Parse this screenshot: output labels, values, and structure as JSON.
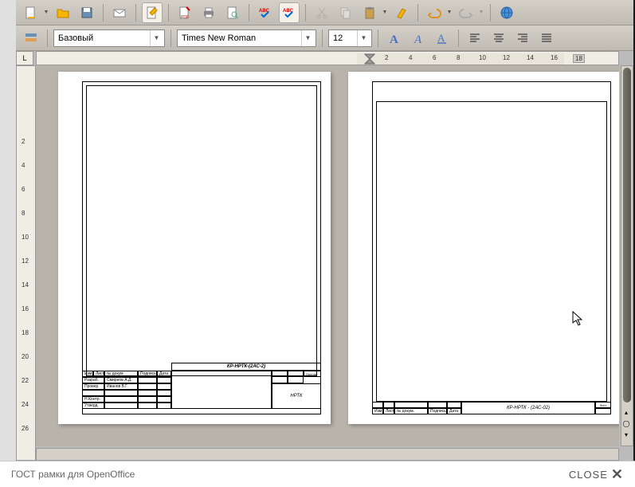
{
  "toolbar1": {
    "icons": [
      "new-doc",
      "open",
      "save",
      "mail",
      "edit-doc",
      "export-pdf",
      "print",
      "print-preview",
      "spellcheck-abc",
      "spellcheck-auto",
      "cut",
      "copy",
      "paste",
      "format-paint",
      "undo",
      "redo",
      "web"
    ]
  },
  "toolbar2": {
    "style_label": "Базовый",
    "font_name": "Times New Roman",
    "font_size": "12"
  },
  "ruler": {
    "h": [
      "2",
      "4",
      "6",
      "8",
      "10",
      "12",
      "14",
      "16",
      "18"
    ],
    "v": [
      "2",
      "4",
      "6",
      "8",
      "10",
      "12",
      "14",
      "16",
      "18",
      "20",
      "22",
      "24",
      "26"
    ]
  },
  "page1": {
    "doc_code": "КР-НРТК-(2АС-2)",
    "rows": [
      {
        "c1": "Изм",
        "c2": "Лист",
        "c3": "№ докум.",
        "c4": "Подпись",
        "c5": "Дата"
      },
      {
        "c1": "Разраб.",
        "c2": "",
        "c3": "Смирнов А.Д.",
        "c4": "",
        "c5": ""
      },
      {
        "c1": "Провер.",
        "c2": "",
        "c3": "Иванов В.Г.",
        "c4": "",
        "c5": ""
      },
      {
        "c1": "",
        "c2": "",
        "c3": "",
        "c4": "",
        "c5": ""
      },
      {
        "c1": "Н.Контр.",
        "c2": "",
        "c3": "",
        "c4": "",
        "c5": ""
      },
      {
        "c1": "Утверд.",
        "c2": "",
        "c3": "",
        "c4": "",
        "c5": ""
      }
    ],
    "org": "НРТК",
    "sheet_label": "Листов"
  },
  "page2": {
    "doc_code": "КР-НРТК - (2АС-02)",
    "row": {
      "c1": "Изм",
      "c2": "Лист",
      "c3": "№ докум.",
      "c4": "Подпись",
      "c5": "Дата"
    },
    "sheet_label": "Лист"
  },
  "footer": {
    "caption": "ГОСТ рамки для OpenOffice",
    "close": "CLOSE"
  }
}
